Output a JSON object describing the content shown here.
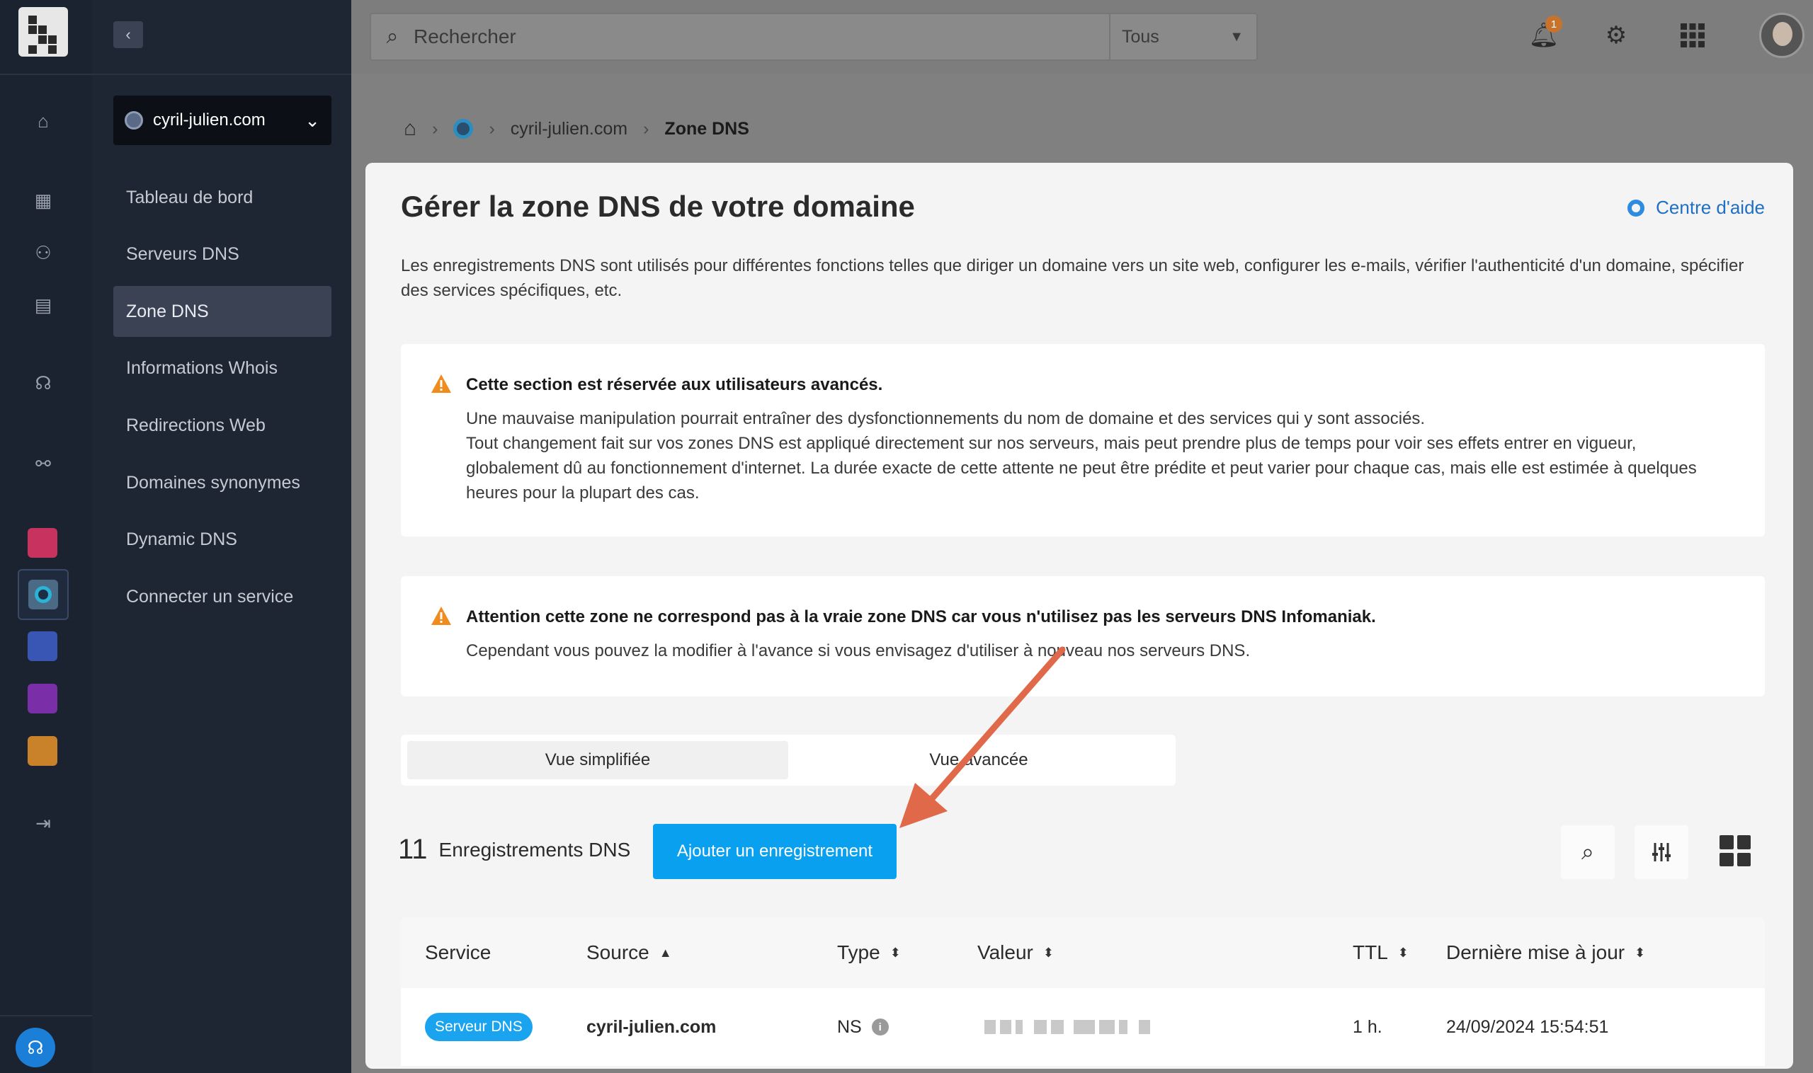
{
  "search": {
    "placeholder": "Rechercher",
    "filter": "Tous"
  },
  "notifications": {
    "count": "1"
  },
  "sidebar": {
    "domain": "cyril-julien.com",
    "items": [
      {
        "label": "Tableau de bord"
      },
      {
        "label": "Serveurs DNS"
      },
      {
        "label": "Zone DNS"
      },
      {
        "label": "Informations Whois"
      },
      {
        "label": "Redirections Web"
      },
      {
        "label": "Domaines synonymes"
      },
      {
        "label": "Dynamic DNS"
      },
      {
        "label": "Connecter un service"
      }
    ],
    "active_index": 2
  },
  "breadcrumb": {
    "domain": "cyril-julien.com",
    "current": "Zone DNS"
  },
  "page": {
    "title": "Gérer la zone DNS de votre domaine",
    "help_link": "Centre d'aide",
    "intro": "Les enregistrements DNS sont utilisés pour différentes fonctions telles que diriger un domaine vers un site web, configurer les e-mails, vérifier l'authenticité d'un domaine, spécifier des services spécifiques, etc."
  },
  "alerts": [
    {
      "title": "Cette section est réservée aux utilisateurs avancés.",
      "body_1": "Une mauvaise manipulation pourrait entraîner des dysfonctionnements du nom de domaine et des services qui y sont associés.",
      "body_2": "Tout changement fait sur vos zones DNS est appliqué directement sur nos serveurs, mais peut prendre plus de temps pour voir ses effets entrer en vigueur, globalement dû au fonctionnement d'internet. La durée exacte de cette attente ne peut être prédite et peut varier pour chaque cas, mais elle est estimée à quelques heures pour la plupart des cas."
    },
    {
      "title": "Attention cette zone ne correspond pas à la vraie zone DNS car vous n'utilisez pas les serveurs DNS Infomaniak.",
      "body_1": "Cependant vous pouvez la modifier à l'avance si vous envisagez d'utiliser à nouveau nos serveurs DNS."
    }
  ],
  "view_toggle": {
    "simple": "Vue simplifiée",
    "advanced": "Vue avancée"
  },
  "records": {
    "count": "11",
    "label": "Enregistrements DNS",
    "add_button": "Ajouter un enregistrement"
  },
  "table": {
    "columns": [
      "Service",
      "Source",
      "Type",
      "Valeur",
      "TTL",
      "Dernière mise à jour"
    ],
    "rows": [
      {
        "service": "Serveur DNS",
        "source": "cyril-julien.com",
        "type": "NS",
        "ttl": "1 h.",
        "updated": "24/09/2024 15:54:51"
      }
    ]
  },
  "colors": {
    "accent": "#0aa0f0",
    "link": "#1f6fc2",
    "warning": "#f08c1e",
    "annotation_arrow": "#e0694a"
  }
}
